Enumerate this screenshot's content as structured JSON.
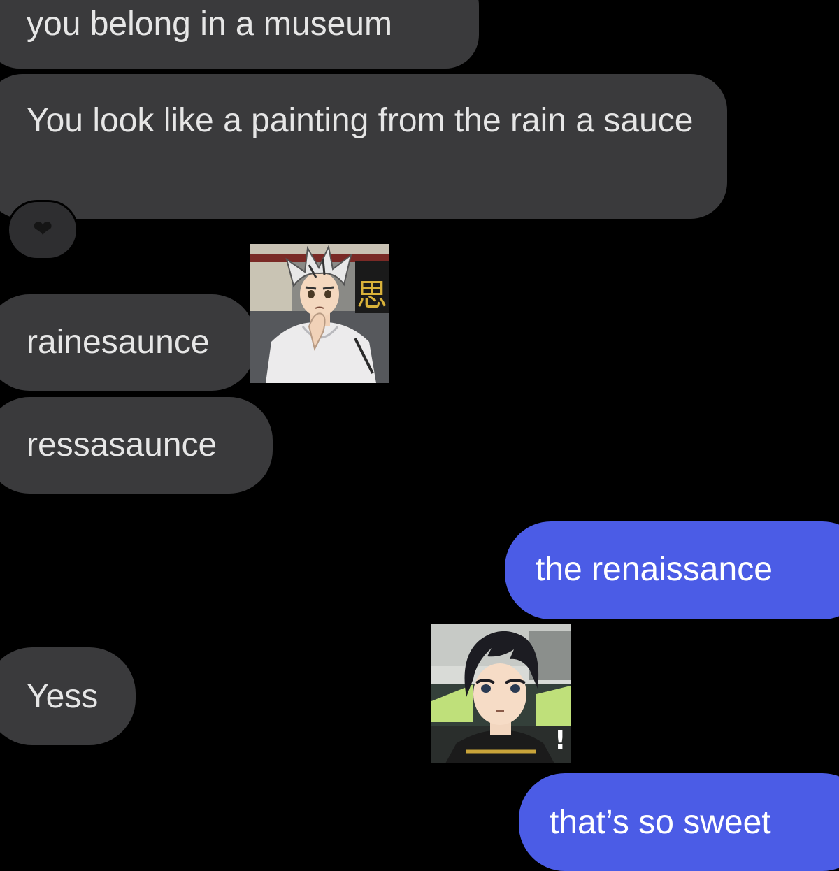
{
  "messages": [
    {
      "id": "b1",
      "side": "incoming",
      "text": "you belong in a museum"
    },
    {
      "id": "b2",
      "side": "incoming",
      "text": "You look like a painting from the rain a sauce"
    },
    {
      "id": "b3",
      "side": "incoming",
      "text": "rainesaunce"
    },
    {
      "id": "b4",
      "side": "incoming",
      "text": "ressasaunce"
    },
    {
      "id": "b5",
      "side": "outgoing",
      "text": "the renaissance"
    },
    {
      "id": "b6",
      "side": "incoming",
      "text": "Yess"
    },
    {
      "id": "b7",
      "side": "outgoing",
      "text": "that’s so sweet"
    }
  ],
  "reaction": {
    "icon": "heart-icon",
    "glyph": "❤"
  },
  "avatars": [
    {
      "name": "white-haired-character-avatar"
    },
    {
      "name": "dark-haired-character-avatar"
    }
  ],
  "colors": {
    "background": "#000000",
    "incoming_bubble": "#3a3a3c",
    "outgoing_bubble": "#4b5ce6",
    "text": "#e6e6e6"
  }
}
